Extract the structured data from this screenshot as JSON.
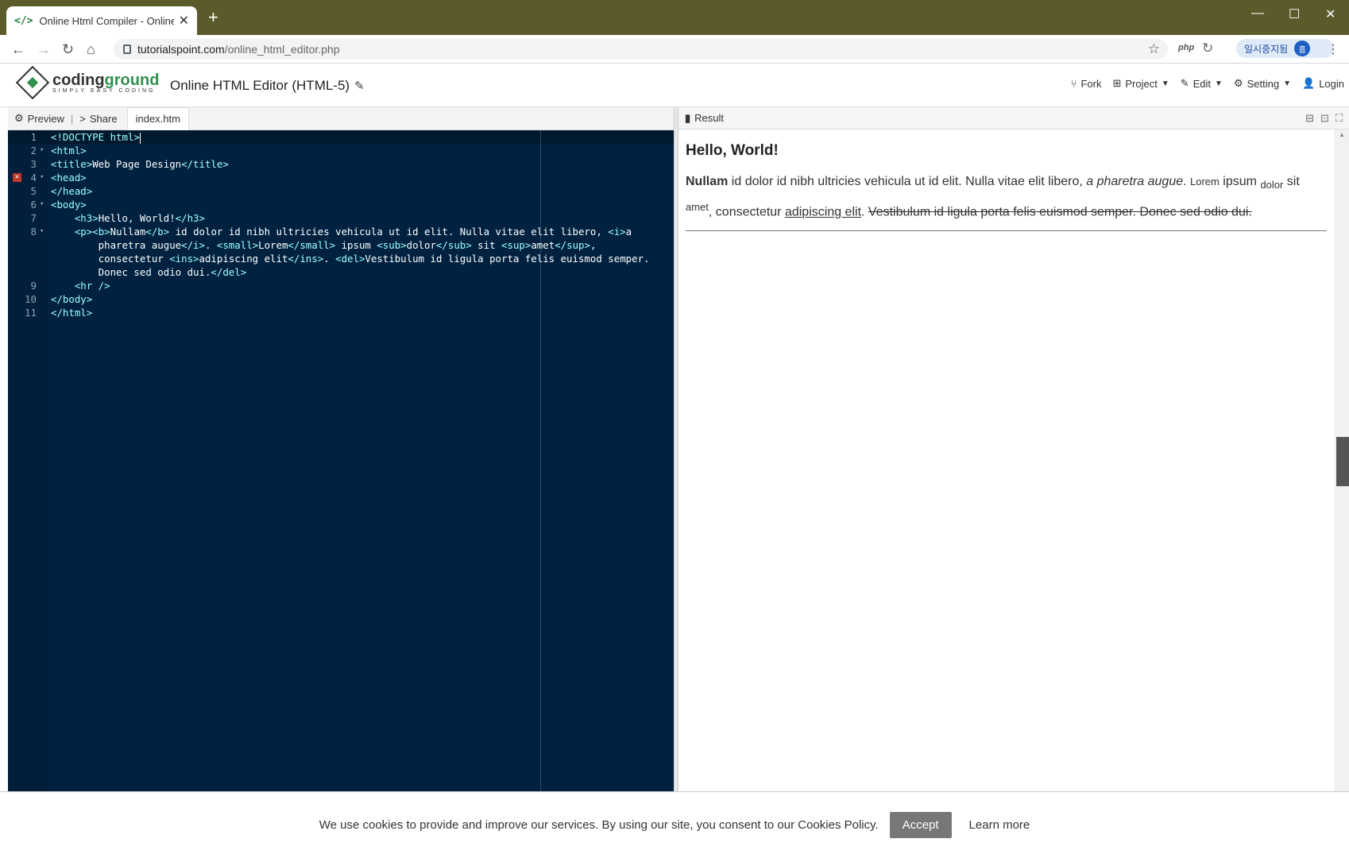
{
  "browser": {
    "tab_title": "Online Html Compiler - Online H",
    "tab_favicon": "</>",
    "url_host": "tutorialspoint.com",
    "url_path": "/online_html_editor.php",
    "ext_php": "php",
    "profile_label": "일시중지됨",
    "profile_avatar": "흠"
  },
  "site": {
    "logo_word_1": "coding",
    "logo_word_2": "ground",
    "logo_tagline": "SIMPLY EASY CODING",
    "page_title": "Online HTML Editor (HTML-5)",
    "menu": {
      "fork": "Fork",
      "project": "Project",
      "edit": "Edit",
      "setting": "Setting",
      "login": "Login"
    }
  },
  "editor": {
    "preview_label": "Preview",
    "share_label": "Share",
    "file_tab": "index.htm",
    "lines": [
      {
        "n": "1",
        "fold": "",
        "error": false,
        "code": "<!DOCTYPE html>"
      },
      {
        "n": "2",
        "fold": "▾",
        "error": false,
        "code": "<html>"
      },
      {
        "n": "3",
        "fold": "",
        "error": false,
        "code": "<title>Web Page Design</title>"
      },
      {
        "n": "4",
        "fold": "▾",
        "error": true,
        "code": "<head>"
      },
      {
        "n": "5",
        "fold": "",
        "error": false,
        "code": "</head>"
      },
      {
        "n": "6",
        "fold": "▾",
        "error": false,
        "code": "<body>"
      },
      {
        "n": "7",
        "fold": "",
        "error": false,
        "code": "    <h3>Hello, World!</h3>"
      },
      {
        "n": "8",
        "fold": "▾",
        "error": false,
        "code": "    <p><b>Nullam</b> id dolor id nibh ultricies vehicula ut id elit. Nulla vitae elit libero, <i>a"
      },
      {
        "n": "",
        "fold": "",
        "error": false,
        "code": "        pharetra augue</i>. <small>Lorem</small> ipsum <sub>dolor</sub> sit <sup>amet</sup>,"
      },
      {
        "n": "",
        "fold": "",
        "error": false,
        "code": "        consectetur <ins>adipiscing elit</ins>. <del>Vestibulum id ligula porta felis euismod semper."
      },
      {
        "n": "",
        "fold": "",
        "error": false,
        "code": "        Donec sed odio dui.</del>"
      },
      {
        "n": "9",
        "fold": "",
        "error": false,
        "code": "    <hr />"
      },
      {
        "n": "10",
        "fold": "",
        "error": false,
        "code": "</body>"
      },
      {
        "n": "11",
        "fold": "",
        "error": false,
        "code": "</html>"
      }
    ]
  },
  "result": {
    "label": "Result",
    "heading": "Hello, World!",
    "p_bold": "Nullam",
    "p_text1": " id dolor id nibh ultricies vehicula ut id elit. Nulla vitae elit libero, ",
    "p_italic": "a pharetra augue",
    "p_text2": ". ",
    "p_small": "Lorem",
    "p_text3": " ipsum ",
    "p_sub": "dolor",
    "p_text4": " sit ",
    "p_sup": "amet",
    "p_text5": ", consectetur ",
    "p_ins": "adipiscing elit",
    "p_text6": ". ",
    "p_del": "Vestibulum id ligula porta felis euismod semper. Donec sed odio dui."
  },
  "cookie": {
    "message": "We use cookies to provide and improve our services. By using our site, you consent to our Cookies Policy.",
    "accept_label": "Accept",
    "learn_label": "Learn more"
  }
}
